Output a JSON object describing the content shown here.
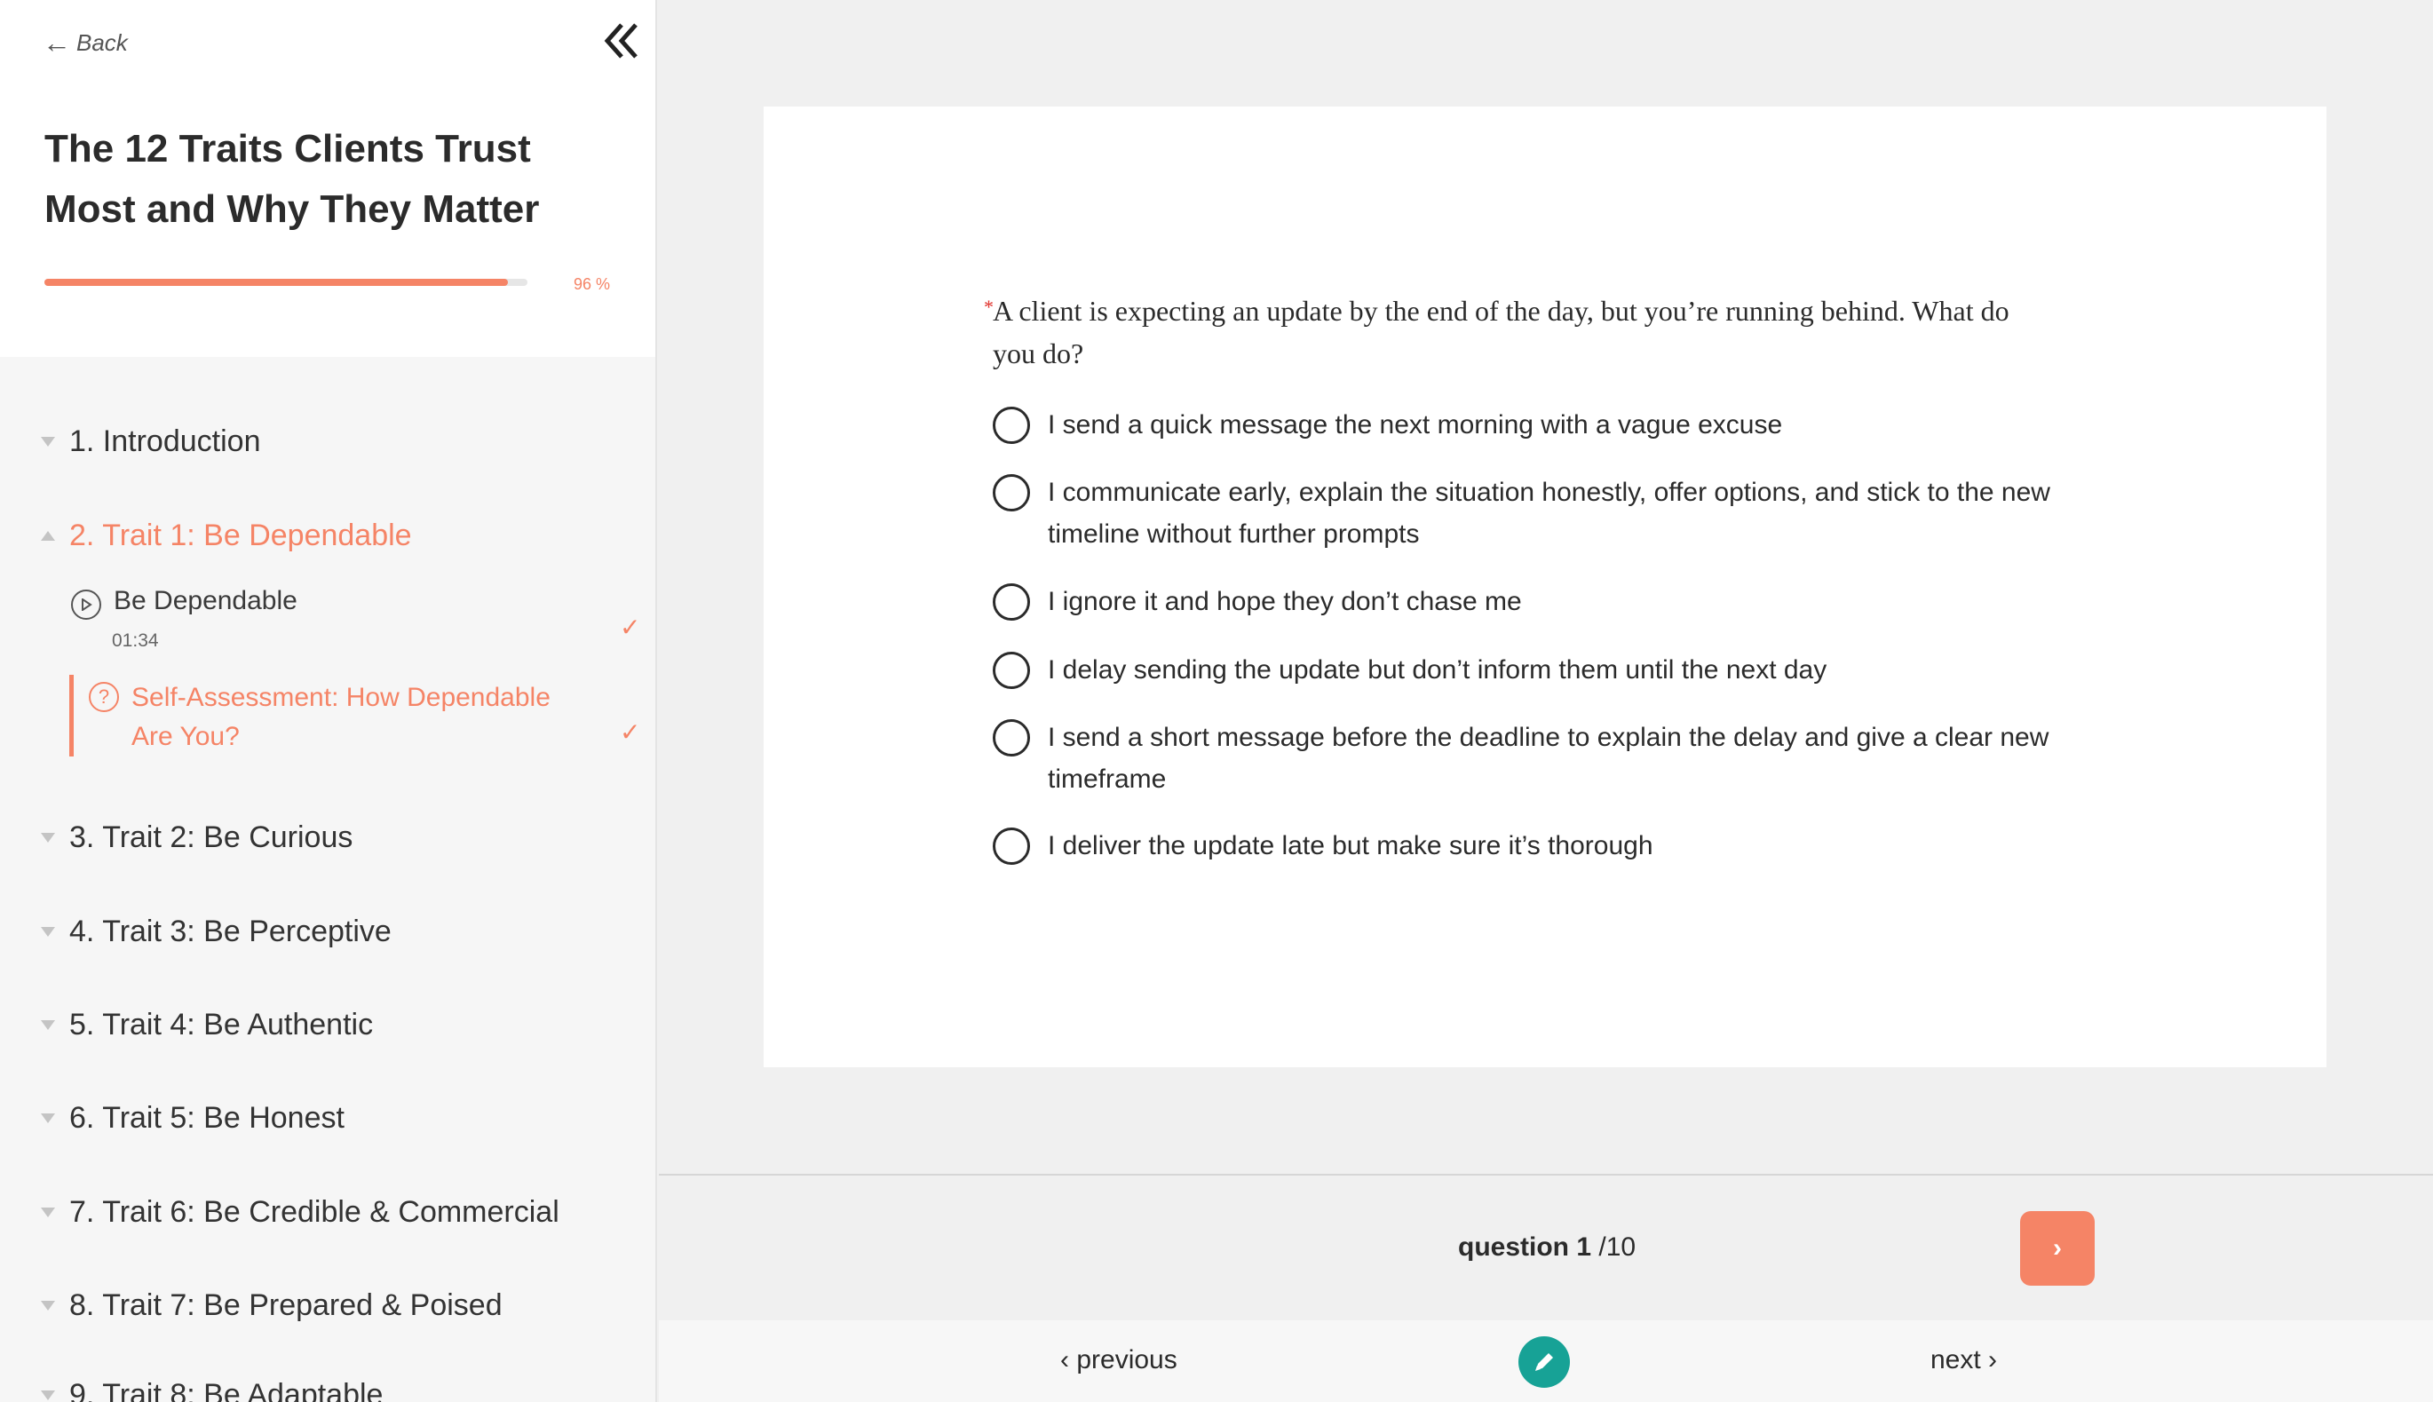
{
  "colors": {
    "accent": "#f58466",
    "edit_button": "#17a296",
    "required": "#e0312b"
  },
  "header": {
    "back_label": "Back",
    "course_title": "The 12 Traits Clients Trust Most and Why They Matter",
    "progress_percent": 96,
    "progress_label": "96 %"
  },
  "sidebar": {
    "sections": [
      {
        "label": "1. Introduction"
      },
      {
        "label": "2. Trait 1: Be Dependable"
      },
      {
        "label": "3. Trait 2: Be Curious"
      },
      {
        "label": "4. Trait 3: Be Perceptive"
      },
      {
        "label": "5. Trait 4: Be Authentic"
      },
      {
        "label": "6. Trait 5: Be Honest"
      },
      {
        "label": "7. Trait 6: Be Credible & Commercial"
      },
      {
        "label": "8. Trait 7: Be Prepared & Poised"
      },
      {
        "label": "9. Trait 8: Be Adaptable"
      }
    ],
    "lessons": [
      {
        "label": "Be Dependable",
        "duration": "01:34",
        "check": "✓"
      },
      {
        "label": "Self-Assessment: How Dependable Are You?",
        "check": "✓"
      }
    ]
  },
  "quiz": {
    "required_mark": "*",
    "question": "A client is expecting an update by the end of the day, but you’re running behind. What do you do?",
    "options": [
      "I send a quick message the next morning with a vague excuse",
      "I communicate early, explain the situation honestly, offer options, and stick to the new timeline without further prompts",
      "I ignore it and hope they don’t chase me",
      "I delay sending the update but don’t inform them until the next day",
      "I send a short message before the deadline to explain the delay and give a clear new timeframe",
      "I deliver the update late but make sure it’s thorough"
    ],
    "counter_prefix": "question",
    "counter_current": "1",
    "counter_total": "/10",
    "next_arrow": "›"
  },
  "footer": {
    "previous_label": "previous",
    "next_label": "next"
  }
}
